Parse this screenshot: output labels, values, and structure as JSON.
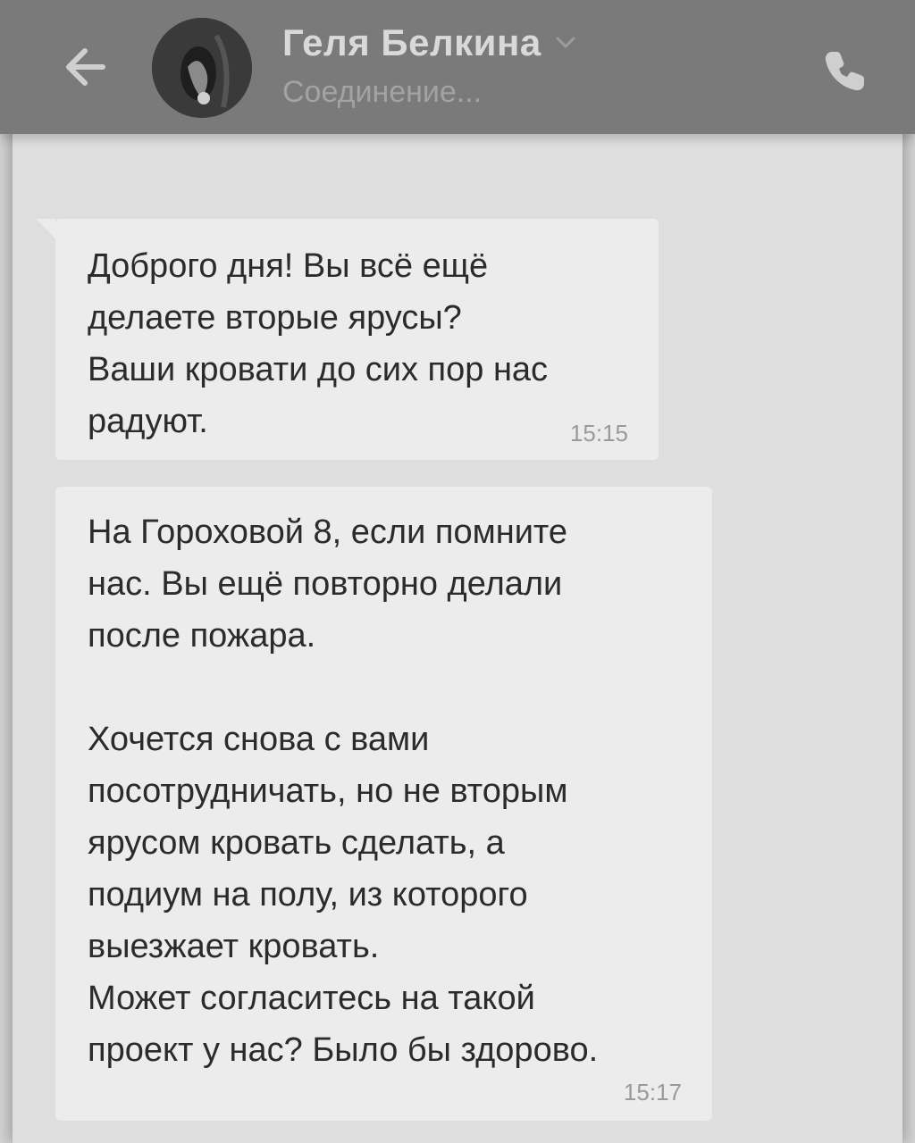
{
  "header": {
    "contact_name": "Геля Белкина",
    "status": "Соединение...",
    "back_icon": "arrow-left-icon",
    "call_icon": "phone-icon",
    "dropdown_icon": "chevron-down-icon"
  },
  "messages": [
    {
      "lines": [
        "Доброго дня! Вы всё ещё",
        "делаете вторые ярусы?",
        "Ваши кровати до сих пор нас",
        "радуют."
      ],
      "time": "15:15"
    },
    {
      "lines": [
        "На Гороховой 8, если помните",
        "нас. Вы ещё повторно делали",
        "после пожара.",
        "",
        "Хочется снова с вами",
        "посотрудничать, но не вторым",
        "ярусом кровать сделать, а",
        "подиум на полу, из которого",
        "выезжает кровать.",
        "Может согласитесь на такой",
        "проект у нас? Было бы здорово."
      ],
      "time": "15:17"
    }
  ],
  "colors": {
    "header_bg": "#7a7a7a",
    "chat_bg": "#dedede",
    "bubble_bg": "#ececec",
    "text": "#2b2b2b"
  }
}
